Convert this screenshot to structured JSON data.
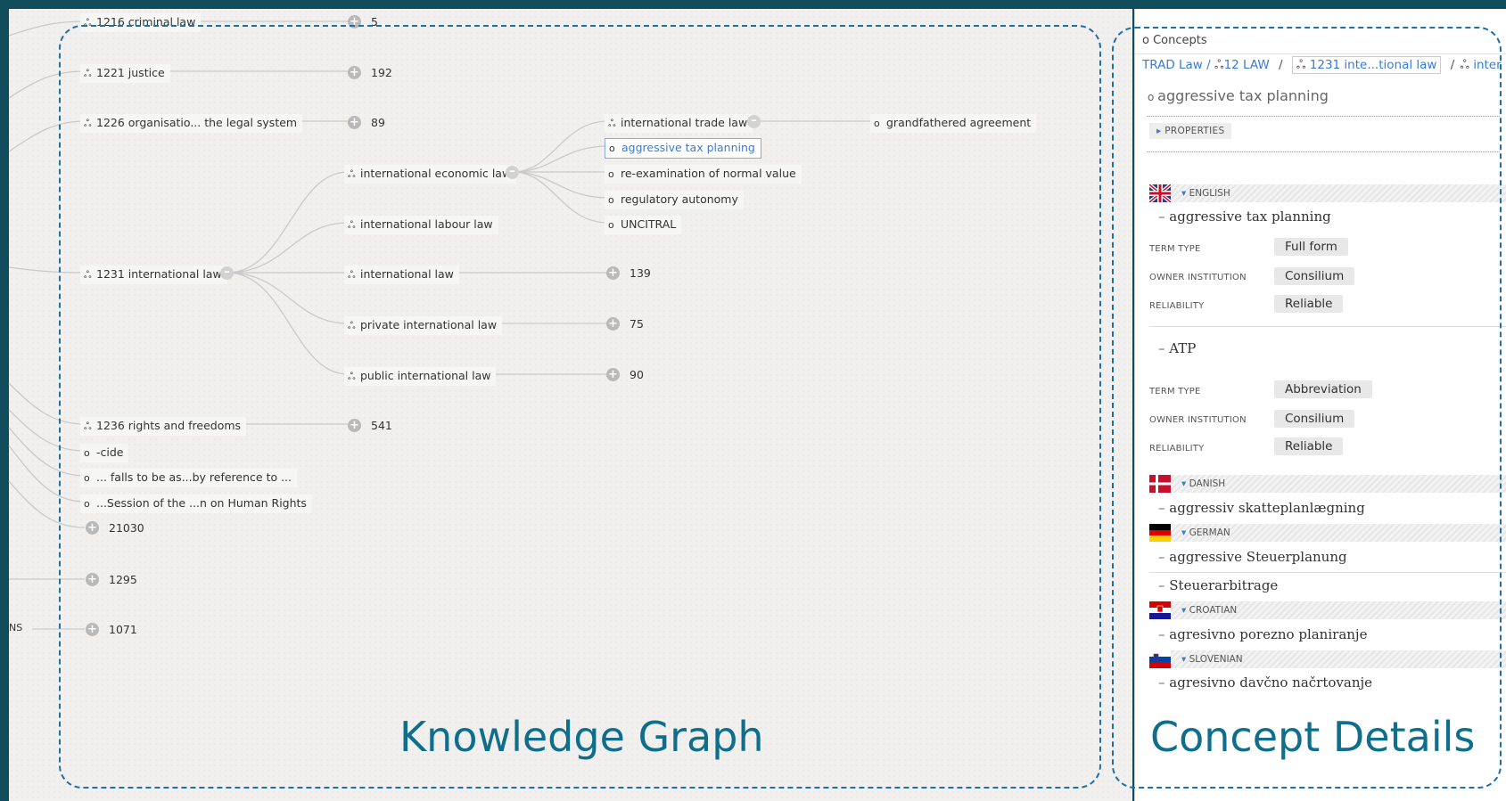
{
  "graph": {
    "nodes": {
      "n1216": "1216 criminal law",
      "n1221": "1221 justice",
      "n1226": "1226 organisatio... the legal system",
      "n1231": "1231 international law",
      "n1236": "1236 rights and freedoms",
      "cide": "-cide",
      "falls": "... falls to be as...by reference to ...",
      "session": "...Session of the ...n on Human Rights",
      "intl_economic": "international economic law",
      "intl_labour": "international labour law",
      "intl_law": "international law",
      "private_intl": "private international law",
      "public_intl": "public international law",
      "intl_trade": "international trade law",
      "aggressive": "aggressive tax planning",
      "reexam": "re-examination of normal value",
      "regulatory": "regulatory autonomy",
      "uncitral": "UNCITRAL",
      "grandfathered": "grandfathered agreement",
      "ns_label": "NS"
    },
    "counts": {
      "c1216": "5",
      "c1221": "192",
      "c1226": "89",
      "c1236": "541",
      "c21030": "21030",
      "c1295": "1295",
      "c1071": "1071",
      "c_intl_law": "139",
      "c_private": "75",
      "c_public": "90"
    },
    "caption": "Knowledge Graph"
  },
  "details": {
    "panel_title": "Concepts",
    "breadcrumbs": [
      "TRAD Law /",
      "12 LAW",
      "1231 inte...tional law",
      "/",
      "inter"
    ],
    "concept_name": "aggressive tax planning",
    "properties_label": "PROPERTIES",
    "caption": "Concept Details",
    "labels": {
      "term_type": "TERM TYPE",
      "owner": "OWNER INSTITUTION",
      "reliability": "RELIABILITY"
    },
    "english": {
      "lang": "ENGLISH",
      "terms": [
        {
          "term": "aggressive tax planning",
          "type": "Full form",
          "owner": "Consilium",
          "reliability": "Reliable"
        },
        {
          "term": "ATP",
          "type": "Abbreviation",
          "owner": "Consilium",
          "reliability": "Reliable"
        }
      ]
    },
    "danish": {
      "lang": "DANISH",
      "terms": [
        "aggressiv skatteplanlægning"
      ]
    },
    "german": {
      "lang": "GERMAN",
      "terms": [
        "aggressive Steuerplanung",
        "Steuerarbitrage"
      ]
    },
    "croatian": {
      "lang": "CROATIAN",
      "terms": [
        "agresivno porezno planiranje"
      ]
    },
    "slovenian": {
      "lang": "SLOVENIAN",
      "terms": [
        "agresivno davčno načrtovanje"
      ]
    }
  },
  "colors": {
    "frame": "#0f4c5c",
    "link": "#3a7bd5",
    "caption": "#0e6e8c",
    "dash": "#1f6fa8"
  },
  "icons": {
    "collection": "collection-icon",
    "concept": "concept-circle-icon",
    "expand": "plus-circle-icon",
    "collapse": "minus-circle-icon"
  }
}
